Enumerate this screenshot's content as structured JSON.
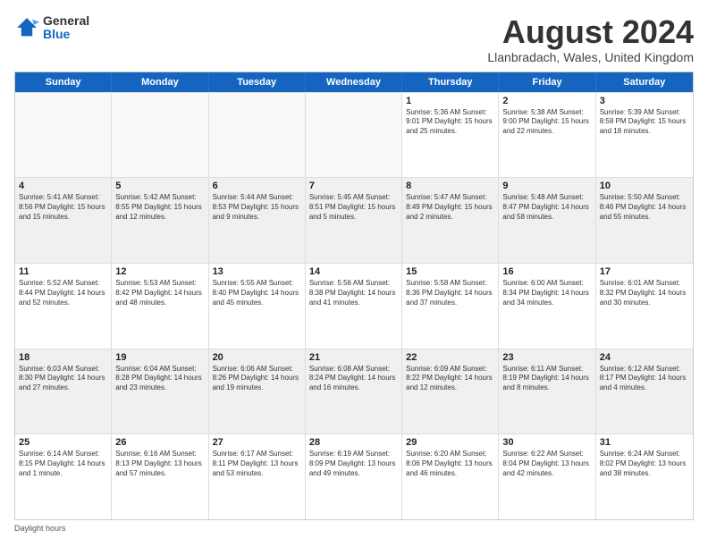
{
  "header": {
    "logo_general": "General",
    "logo_blue": "Blue",
    "month_title": "August 2024",
    "location": "Llanbradach, Wales, United Kingdom"
  },
  "days_of_week": [
    "Sunday",
    "Monday",
    "Tuesday",
    "Wednesday",
    "Thursday",
    "Friday",
    "Saturday"
  ],
  "rows": [
    [
      {
        "day": "",
        "info": ""
      },
      {
        "day": "",
        "info": ""
      },
      {
        "day": "",
        "info": ""
      },
      {
        "day": "",
        "info": ""
      },
      {
        "day": "1",
        "info": "Sunrise: 5:36 AM\nSunset: 9:01 PM\nDaylight: 15 hours\nand 25 minutes."
      },
      {
        "day": "2",
        "info": "Sunrise: 5:38 AM\nSunset: 9:00 PM\nDaylight: 15 hours\nand 22 minutes."
      },
      {
        "day": "3",
        "info": "Sunrise: 5:39 AM\nSunset: 8:58 PM\nDaylight: 15 hours\nand 18 minutes."
      }
    ],
    [
      {
        "day": "4",
        "info": "Sunrise: 5:41 AM\nSunset: 8:56 PM\nDaylight: 15 hours\nand 15 minutes."
      },
      {
        "day": "5",
        "info": "Sunrise: 5:42 AM\nSunset: 8:55 PM\nDaylight: 15 hours\nand 12 minutes."
      },
      {
        "day": "6",
        "info": "Sunrise: 5:44 AM\nSunset: 8:53 PM\nDaylight: 15 hours\nand 9 minutes."
      },
      {
        "day": "7",
        "info": "Sunrise: 5:45 AM\nSunset: 8:51 PM\nDaylight: 15 hours\nand 5 minutes."
      },
      {
        "day": "8",
        "info": "Sunrise: 5:47 AM\nSunset: 8:49 PM\nDaylight: 15 hours\nand 2 minutes."
      },
      {
        "day": "9",
        "info": "Sunrise: 5:48 AM\nSunset: 8:47 PM\nDaylight: 14 hours\nand 58 minutes."
      },
      {
        "day": "10",
        "info": "Sunrise: 5:50 AM\nSunset: 8:46 PM\nDaylight: 14 hours\nand 55 minutes."
      }
    ],
    [
      {
        "day": "11",
        "info": "Sunrise: 5:52 AM\nSunset: 8:44 PM\nDaylight: 14 hours\nand 52 minutes."
      },
      {
        "day": "12",
        "info": "Sunrise: 5:53 AM\nSunset: 8:42 PM\nDaylight: 14 hours\nand 48 minutes."
      },
      {
        "day": "13",
        "info": "Sunrise: 5:55 AM\nSunset: 8:40 PM\nDaylight: 14 hours\nand 45 minutes."
      },
      {
        "day": "14",
        "info": "Sunrise: 5:56 AM\nSunset: 8:38 PM\nDaylight: 14 hours\nand 41 minutes."
      },
      {
        "day": "15",
        "info": "Sunrise: 5:58 AM\nSunset: 8:36 PM\nDaylight: 14 hours\nand 37 minutes."
      },
      {
        "day": "16",
        "info": "Sunrise: 6:00 AM\nSunset: 8:34 PM\nDaylight: 14 hours\nand 34 minutes."
      },
      {
        "day": "17",
        "info": "Sunrise: 6:01 AM\nSunset: 8:32 PM\nDaylight: 14 hours\nand 30 minutes."
      }
    ],
    [
      {
        "day": "18",
        "info": "Sunrise: 6:03 AM\nSunset: 8:30 PM\nDaylight: 14 hours\nand 27 minutes."
      },
      {
        "day": "19",
        "info": "Sunrise: 6:04 AM\nSunset: 8:28 PM\nDaylight: 14 hours\nand 23 minutes."
      },
      {
        "day": "20",
        "info": "Sunrise: 6:06 AM\nSunset: 8:26 PM\nDaylight: 14 hours\nand 19 minutes."
      },
      {
        "day": "21",
        "info": "Sunrise: 6:08 AM\nSunset: 8:24 PM\nDaylight: 14 hours\nand 16 minutes."
      },
      {
        "day": "22",
        "info": "Sunrise: 6:09 AM\nSunset: 8:22 PM\nDaylight: 14 hours\nand 12 minutes."
      },
      {
        "day": "23",
        "info": "Sunrise: 6:11 AM\nSunset: 8:19 PM\nDaylight: 14 hours\nand 8 minutes."
      },
      {
        "day": "24",
        "info": "Sunrise: 6:12 AM\nSunset: 8:17 PM\nDaylight: 14 hours\nand 4 minutes."
      }
    ],
    [
      {
        "day": "25",
        "info": "Sunrise: 6:14 AM\nSunset: 8:15 PM\nDaylight: 14 hours\nand 1 minute."
      },
      {
        "day": "26",
        "info": "Sunrise: 6:16 AM\nSunset: 8:13 PM\nDaylight: 13 hours\nand 57 minutes."
      },
      {
        "day": "27",
        "info": "Sunrise: 6:17 AM\nSunset: 8:11 PM\nDaylight: 13 hours\nand 53 minutes."
      },
      {
        "day": "28",
        "info": "Sunrise: 6:19 AM\nSunset: 8:09 PM\nDaylight: 13 hours\nand 49 minutes."
      },
      {
        "day": "29",
        "info": "Sunrise: 6:20 AM\nSunset: 8:06 PM\nDaylight: 13 hours\nand 46 minutes."
      },
      {
        "day": "30",
        "info": "Sunrise: 6:22 AM\nSunset: 8:04 PM\nDaylight: 13 hours\nand 42 minutes."
      },
      {
        "day": "31",
        "info": "Sunrise: 6:24 AM\nSunset: 8:02 PM\nDaylight: 13 hours\nand 38 minutes."
      }
    ]
  ],
  "footer": "Daylight hours"
}
